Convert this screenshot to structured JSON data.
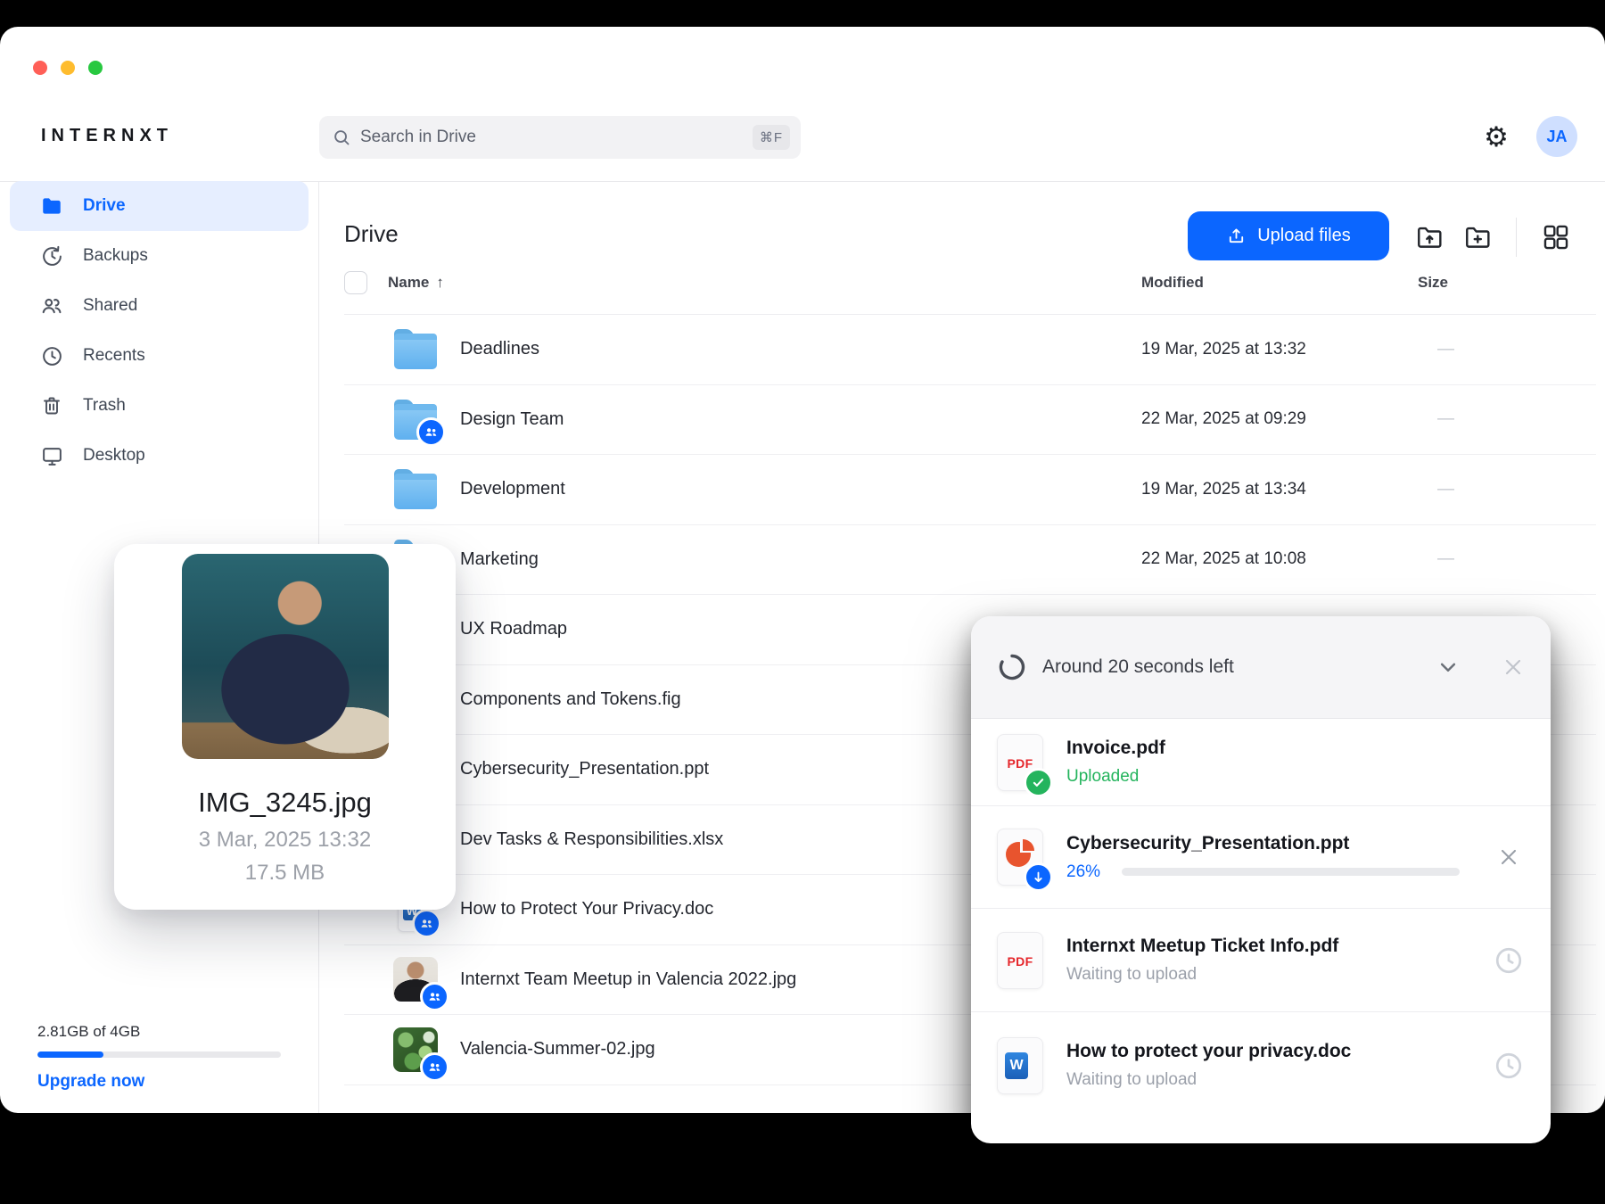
{
  "window": {
    "traffic_lights": [
      "#ff5f57",
      "#febc2e",
      "#28c840"
    ]
  },
  "brand": {
    "logo": "INTERNXT"
  },
  "topbar": {
    "search_placeholder": "Search in Drive",
    "search_shortcut": "⌘F",
    "avatar_initials": "JA"
  },
  "sidebar": {
    "items": [
      {
        "label": "Drive",
        "icon": "folder-icon",
        "active": true
      },
      {
        "label": "Backups",
        "icon": "history-icon",
        "active": false
      },
      {
        "label": "Shared",
        "icon": "people-icon",
        "active": false
      },
      {
        "label": "Recents",
        "icon": "clock-icon",
        "active": false
      },
      {
        "label": "Trash",
        "icon": "trash-icon",
        "active": false
      },
      {
        "label": "Desktop",
        "icon": "monitor-icon",
        "active": false
      }
    ],
    "storage": {
      "usage": "2.81GB of 4GB",
      "used_percent": 27,
      "upgrade_label": "Upgrade now"
    }
  },
  "main": {
    "title": "Drive",
    "upload_button_label": "Upload files",
    "columns": {
      "name": "Name",
      "sort_arrow": "↑",
      "modified": "Modified",
      "size": "Size"
    },
    "rows": [
      {
        "name": "Deadlines",
        "modified": "19 Mar, 2025 at 13:32",
        "size": "—",
        "icon": "folder"
      },
      {
        "name": "Design Team",
        "modified": "22 Mar, 2025 at 09:29",
        "size": "—",
        "icon": "folder-shared"
      },
      {
        "name": "Development",
        "modified": "19 Mar, 2025 at 13:34",
        "size": "—",
        "icon": "folder"
      },
      {
        "name": "Marketing",
        "modified": "22 Mar, 2025 at 10:08",
        "size": "—",
        "icon": "folder"
      },
      {
        "name": "UX Roadmap",
        "modified": "",
        "size": "",
        "icon": "folder"
      },
      {
        "name": "Components and Tokens.fig",
        "modified": "",
        "size": "",
        "icon": "file"
      },
      {
        "name": "Cybersecurity_Presentation.ppt",
        "modified": "",
        "size": "",
        "icon": "file"
      },
      {
        "name": "Dev Tasks & Responsibilities.xlsx",
        "modified": "",
        "size": "",
        "icon": "file"
      },
      {
        "name": "How to Protect Your Privacy.doc",
        "modified": "",
        "size": "",
        "icon": "doc"
      },
      {
        "name": "Internxt Team Meetup in Valencia 2022.jpg",
        "modified": "",
        "size": "",
        "icon": "img-portrait"
      },
      {
        "name": "Valencia-Summer-02.jpg",
        "modified": "",
        "size": "",
        "icon": "img-leaves"
      }
    ]
  },
  "preview_card": {
    "filename": "IMG_3245.jpg",
    "date": "3 Mar, 2025 13:32",
    "size": "17.5 MB"
  },
  "upload_panel": {
    "status_text": "Around 20 seconds left",
    "items": [
      {
        "name": "Invoice.pdf",
        "status": "Uploaded",
        "status_type": "success",
        "icon": "pdf",
        "icon_label": "PDF"
      },
      {
        "name": "Cybersecurity_Presentation.ppt",
        "status": "26%",
        "status_type": "progress",
        "progress": 26,
        "icon": "ppt",
        "icon_label": ""
      },
      {
        "name": "Internxt Meetup Ticket Info.pdf",
        "status": "Waiting to upload",
        "status_type": "waiting",
        "icon": "pdf",
        "icon_label": "PDF"
      },
      {
        "name": "How to protect your privacy.doc",
        "status": "Waiting to upload",
        "status_type": "waiting",
        "icon": "doc",
        "icon_label": ""
      }
    ]
  },
  "colors": {
    "accent": "#0b66ff",
    "success": "#24b45d",
    "pdf_red": "#e5252a",
    "ppt_orange": "#e8542e"
  }
}
